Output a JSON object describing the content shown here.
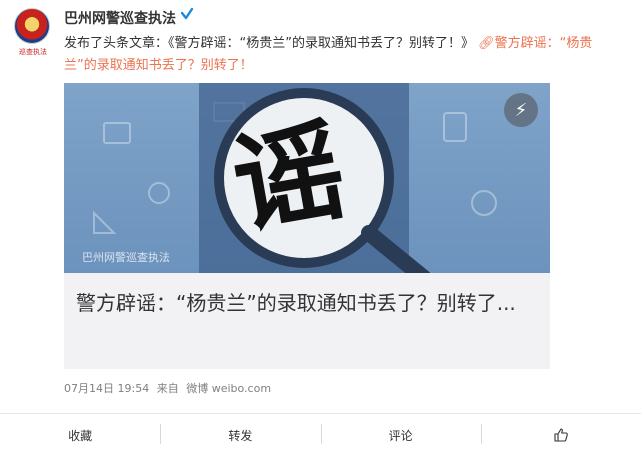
{
  "author": {
    "name": "巴州网警巡查执法",
    "avatar_caption": "巡查执法"
  },
  "post": {
    "prefix": "发布了头条文章：",
    "article_title_quoted": "《警方辟谣：“杨贵兰”的录取通知书丢了？别转了！》",
    "link_text": "警方辟谣：“杨贵兰”的录取通知书丢了？别转了！"
  },
  "card": {
    "image_text": "谣",
    "watermark": "巴州网警巡查执法",
    "title": "警方辟谣：“杨贵兰”的录取通知书丢了？别转了..."
  },
  "meta": {
    "date": "07月14日 19:54",
    "from": "来自",
    "source": "微博 weibo.com"
  },
  "actions": {
    "favorite": "收藏",
    "repost": "转发",
    "comment": "评论"
  },
  "colors": {
    "link": "#eb7350",
    "verified": "#1a8cd8"
  },
  "icons": {
    "verified": "verified-icon",
    "link": "link-icon",
    "badge": "lightning-icon",
    "like": "thumbs-up-icon"
  }
}
